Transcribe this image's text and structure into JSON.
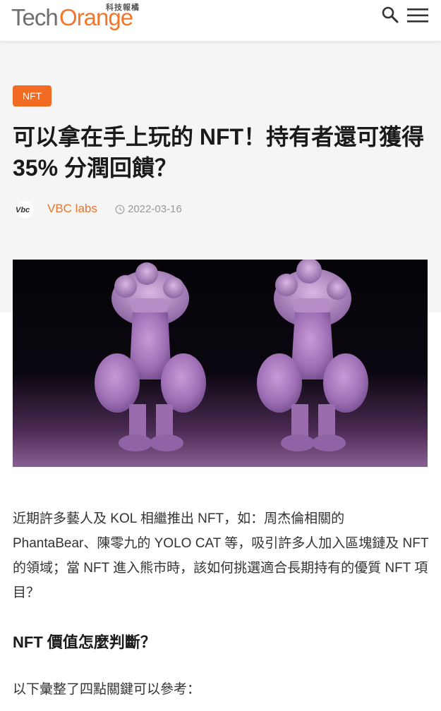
{
  "header": {
    "logo_tech": "Tech",
    "logo_orange": "Orange",
    "logo_subtitle": "科技報橘",
    "search_icon": "search-icon",
    "menu_icon": "hamburger-menu-icon"
  },
  "article": {
    "category_tag": "NFT",
    "title": "可以拿在手上玩的 NFT！持有者還可獲得 35% 分潤回饋？",
    "author_logo": "Vbc",
    "author": "VBC labs",
    "date": "2022-03-16",
    "intro": "近期許多藝人及 KOL 相繼推出 NFT，如：周杰倫相關的 PhantaBear、陳零九的 YOLO CAT 等，吸引許多人加入區塊鏈及 NFT 的領域；當 NFT 進入熊市時，該如何挑選適合長期持有的優質 NFT 項目？",
    "section_heading": "NFT 價值怎麼判斷？",
    "section_text": "以下彙整了四點關鍵可以參考："
  },
  "colors": {
    "brand_orange": "#f26b22",
    "author_orange": "#e8752c",
    "logo_gray": "#6e6e6e"
  }
}
